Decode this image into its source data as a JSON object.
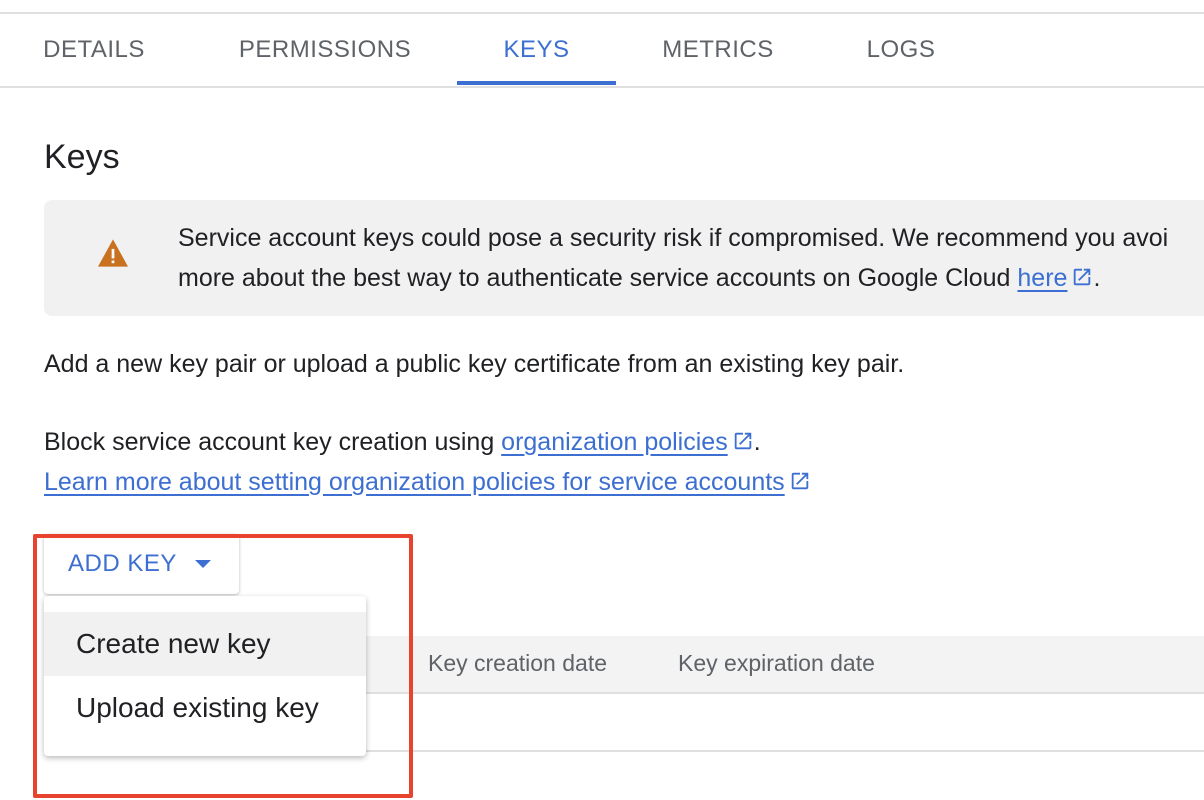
{
  "tabs": [
    {
      "label": "DETAILS",
      "active": false
    },
    {
      "label": "PERMISSIONS",
      "active": false
    },
    {
      "label": "KEYS",
      "active": true
    },
    {
      "label": "METRICS",
      "active": false
    },
    {
      "label": "LOGS",
      "active": false
    }
  ],
  "heading": "Keys",
  "warning": {
    "line1": "Service account keys could pose a security risk if compromised. We recommend you avoi",
    "line2_prefix": "more about the best way to authenticate service accounts on Google Cloud ",
    "link": "here",
    "line2_suffix": ".",
    "icon": "warning-icon"
  },
  "intro": "Add a new key pair or upload a public key certificate from an existing key pair.",
  "policy": {
    "prefix": "Block service account key creation using ",
    "link": "organization policies",
    "suffix": ".",
    "learn_more": "Learn more about setting organization policies for service accounts"
  },
  "add_key_button": {
    "label": "ADD KEY",
    "icon": "arrow-drop-down-icon"
  },
  "menu": {
    "items": [
      {
        "label": "Create new key",
        "highlighted": true
      },
      {
        "label": "Upload existing key",
        "highlighted": false
      }
    ]
  },
  "table": {
    "headers": [
      "Key creation date",
      "Key expiration date"
    ]
  },
  "colors": {
    "accent": "#3c6fd1",
    "warning": "#c9711f",
    "highlight_frame": "#e8432f"
  }
}
